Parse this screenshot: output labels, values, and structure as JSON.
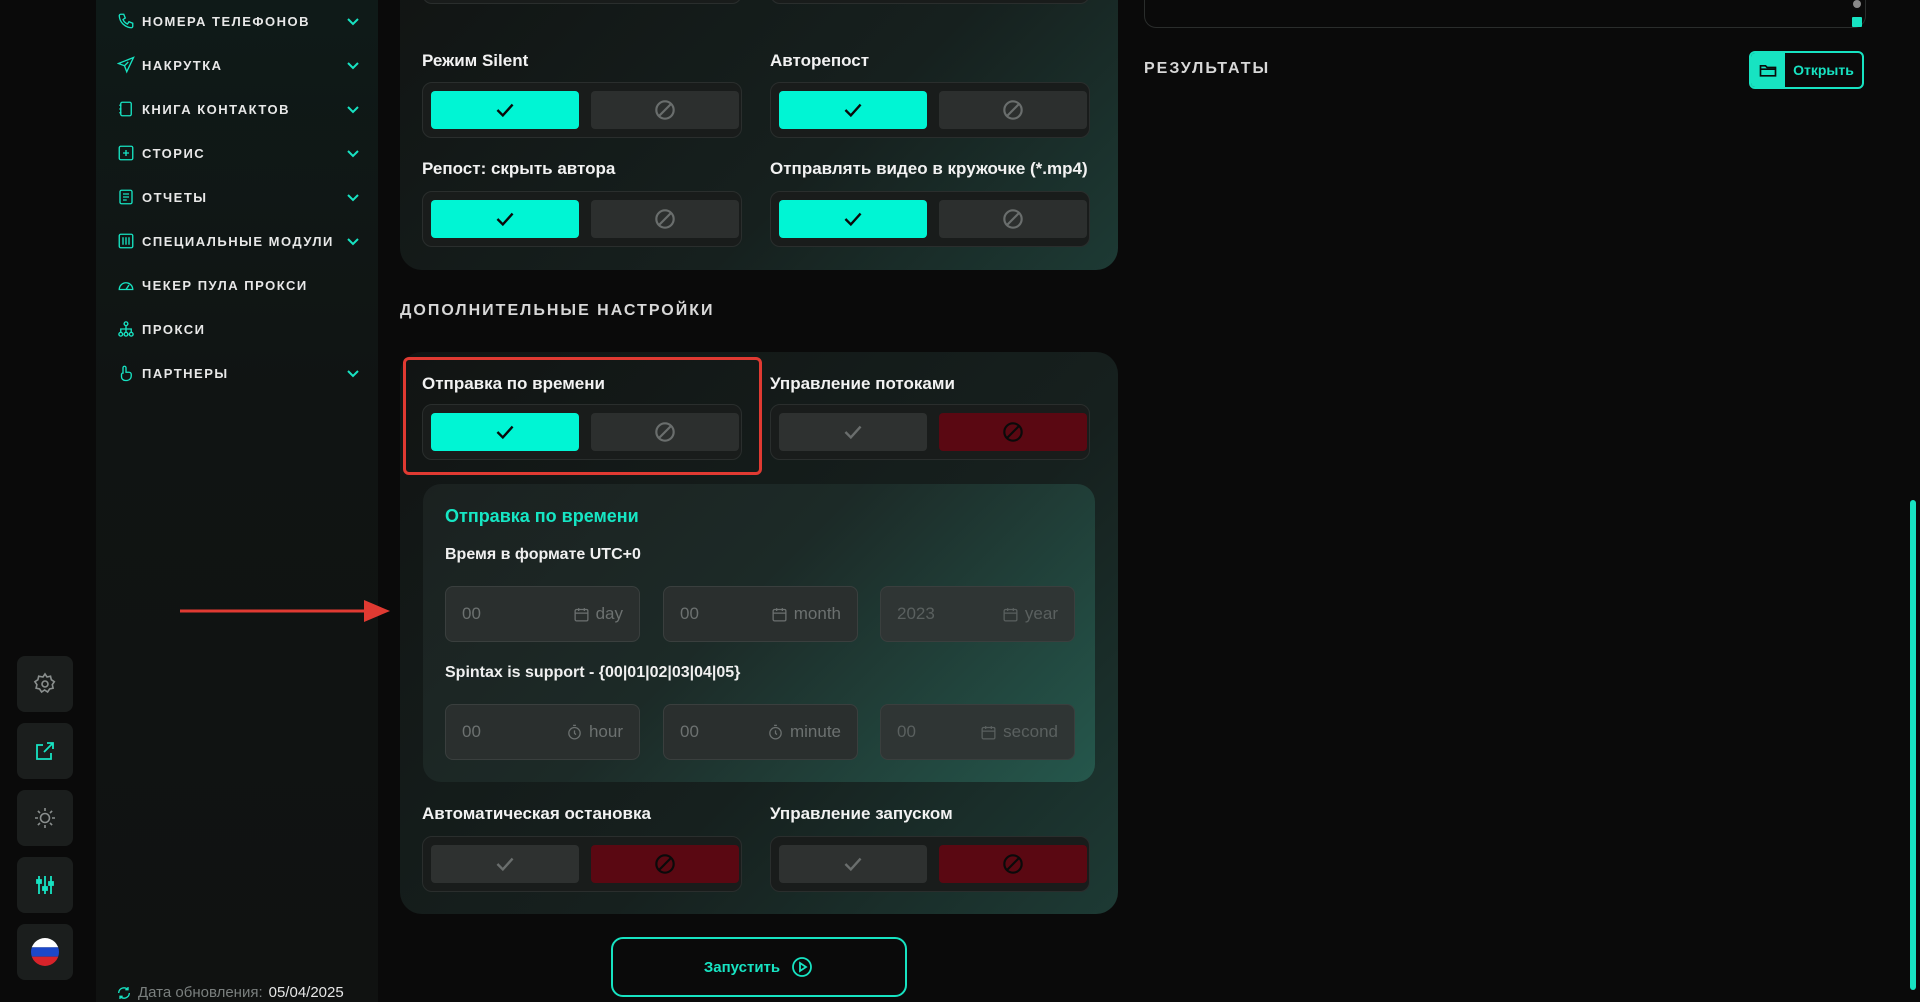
{
  "sidebar": {
    "items": [
      {
        "label": "НОМЕРА ТЕЛЕФОНОВ",
        "icon": "phone-icon",
        "expandable": true
      },
      {
        "label": "НАКРУТКА",
        "icon": "paper-plane-icon",
        "expandable": true
      },
      {
        "label": "КНИГА КОНТАКТОВ",
        "icon": "address-book-icon",
        "expandable": true
      },
      {
        "label": "СТОРИС",
        "icon": "plus-square-icon",
        "expandable": true
      },
      {
        "label": "ОТЧЕТЫ",
        "icon": "report-icon",
        "expandable": true
      },
      {
        "label": "СПЕЦИАЛЬНЫЕ МОДУЛИ",
        "icon": "modules-icon",
        "expandable": true
      },
      {
        "label": "ЧЕКЕР ПУЛА ПРОКСИ",
        "icon": "gauge-icon",
        "expandable": false
      },
      {
        "label": "ПРОКСИ",
        "icon": "network-icon",
        "expandable": false
      },
      {
        "label": "ПАРТНЕРЫ",
        "icon": "hand-icon",
        "expandable": true
      }
    ],
    "update_label": "Дата обновления:",
    "update_date": "05/04/2025"
  },
  "rail": {
    "buttons": [
      "settings-icon",
      "external-link-icon",
      "brightness-icon",
      "sliders-icon",
      "flag-ru-icon"
    ]
  },
  "options": {
    "silent_label": "Режим Silent",
    "silent_value": true,
    "autorepost_label": "Авторепост",
    "autorepost_value": true,
    "hide_author_label": "Репост: скрыть автора",
    "hide_author_value": true,
    "video_circle_label": "Отправлять видео в кружочке (*.mp4)",
    "video_circle_value": true
  },
  "extra": {
    "section_title": "ДОПОЛНИТЕЛЬНЫЕ НАСТРОЙКИ",
    "timed_label": "Отправка по времени",
    "timed_value": true,
    "threads_label": "Управление потоками",
    "threads_value": false,
    "auto_stop_label": "Автоматическая остановка",
    "auto_stop_value": false,
    "launch_control_label": "Управление запуском",
    "launch_control_value": false
  },
  "schedule": {
    "title": "Отправка по времени",
    "time_format_label": "Время в формате UTC+0",
    "spintax_label": "Spintax is support - {00|01|02|03|04|05}",
    "day": {
      "value": "00",
      "unit": "day"
    },
    "month": {
      "value": "00",
      "unit": "month"
    },
    "year": {
      "value": "2023",
      "unit": "year"
    },
    "hour": {
      "value": "00",
      "unit": "hour"
    },
    "minute": {
      "value": "00",
      "unit": "minute"
    },
    "second": {
      "value": "00",
      "unit": "second"
    }
  },
  "launch_button": "Запустить",
  "results": {
    "title": "РЕЗУЛЬТАТЫ",
    "open_button": "Открыть"
  },
  "colors": {
    "accent": "#00f5d4",
    "danger": "#5a0812",
    "annotation": "#e03a32"
  }
}
